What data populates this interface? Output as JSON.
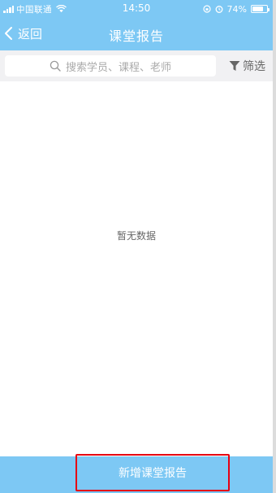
{
  "status_bar": {
    "carrier": "中国联通",
    "time": "14:50",
    "battery": "74%",
    "battery_level": 0.74
  },
  "navbar": {
    "back_label": "返回",
    "title": "课堂报告"
  },
  "search": {
    "placeholder": "搜索学员、课程、老师"
  },
  "filter": {
    "label": "筛选"
  },
  "content": {
    "empty_text": "暂无数据"
  },
  "footer": {
    "add_button_label": "新增课堂报告"
  },
  "colors": {
    "header": "#7dc8f4",
    "highlight_border": "#e60012"
  }
}
